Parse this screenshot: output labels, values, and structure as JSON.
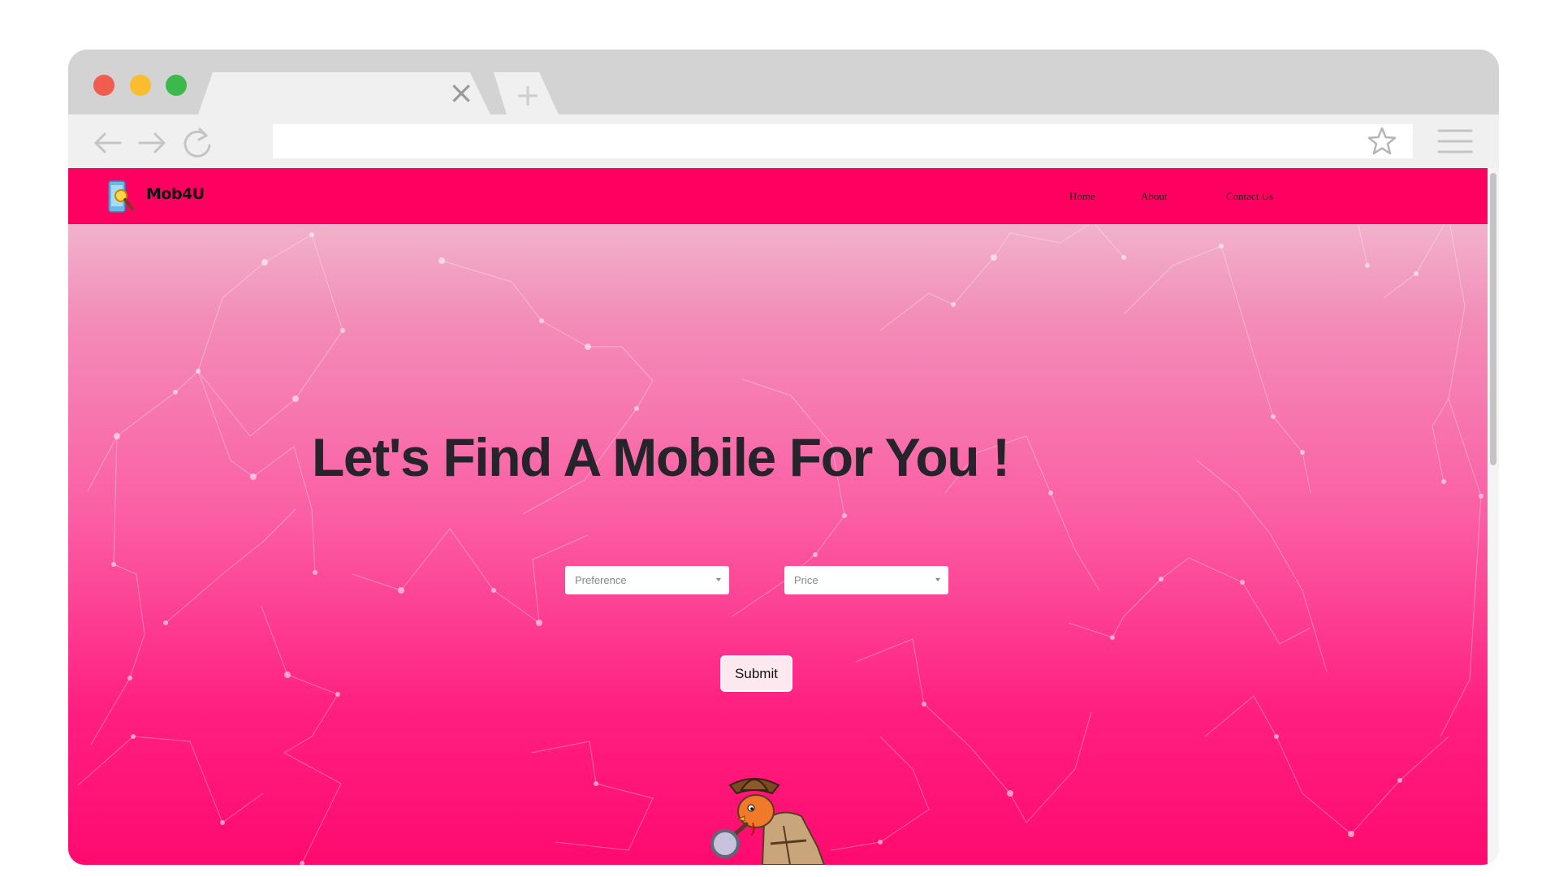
{
  "browser": {
    "tab_close_glyph": "×",
    "new_tab_glyph": "+"
  },
  "page": {
    "brand": "Mob4U",
    "nav": [
      {
        "label": "Home"
      },
      {
        "label": "About"
      },
      {
        "label": "Contact Us"
      }
    ],
    "headline": "Let's Find A Mobile For You !",
    "preference_select": {
      "placeholder": "Preference"
    },
    "price_select": {
      "placeholder": "Price"
    },
    "submit_label": "Submit"
  },
  "colors": {
    "navbar": "#ff0061",
    "gradient_top": "#f0c8d6",
    "gradient_bottom": "#ff0a6f"
  },
  "icons": {
    "back": "arrow-left-icon",
    "forward": "arrow-right-icon",
    "reload": "reload-icon",
    "bookmark": "star-icon",
    "menu": "hamburger-menu-icon",
    "logo": "phone-magnifier-logo",
    "mascot": "detective-mascot"
  }
}
